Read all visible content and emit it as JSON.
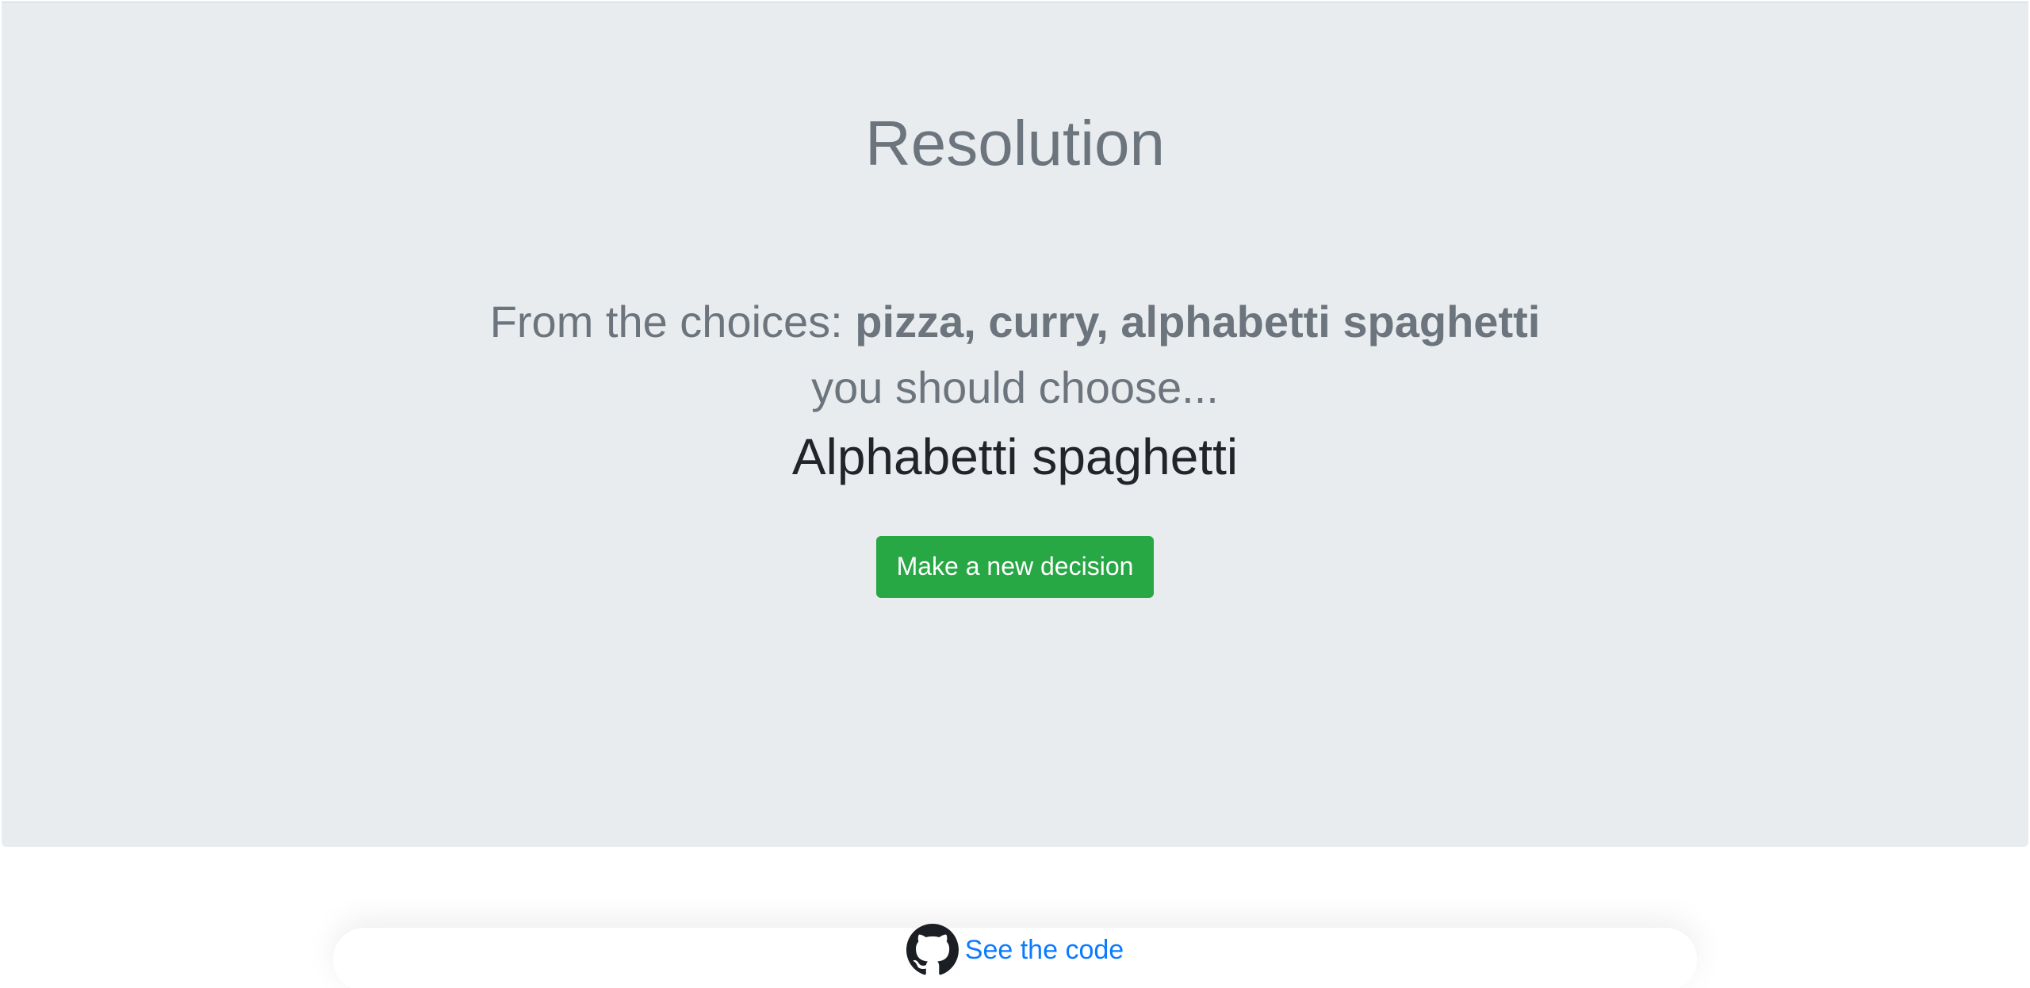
{
  "hero": {
    "title": "Resolution",
    "choices_prefix": "From the choices: ",
    "choices": "pizza, curry, alphabetti spaghetti",
    "should_text": "you should choose...",
    "result": "Alphabetti spaghetti",
    "new_decision_label": "Make a new decision"
  },
  "footer": {
    "icon": "github-icon",
    "link_text": "See the code"
  },
  "colors": {
    "hero_background": "#e9ecef",
    "muted_text": "#6c757d",
    "result_text": "#212529",
    "button_green": "#28a745",
    "link_blue": "#0b7bff"
  }
}
